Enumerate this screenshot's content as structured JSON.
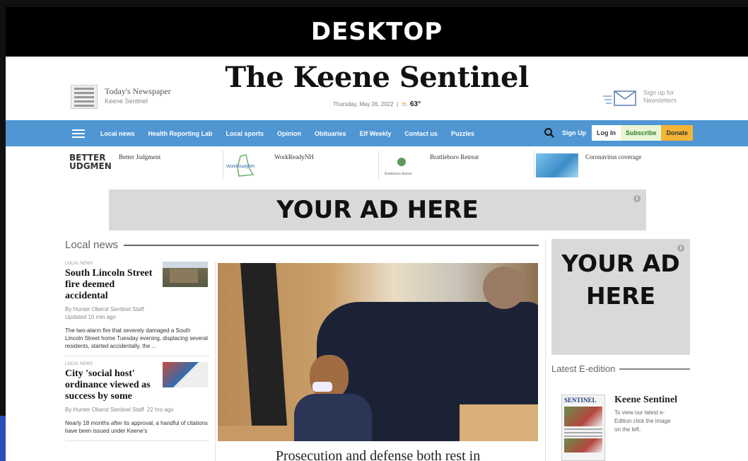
{
  "banner": {
    "label": "DESKTOP"
  },
  "masthead": {
    "todays_newspaper": "Today's Newspaper",
    "todays_sub": "Keene Sentinel",
    "logo": "The Keene Sentinel",
    "date": "Thursday, May 26, 2022",
    "temp": "63°",
    "newsletter": "Sign up for Newsletters"
  },
  "nav": {
    "items": [
      "Local news",
      "Health Reporting Lab",
      "Local sports",
      "Opinion",
      "Obituaries",
      "Elf Weekly",
      "Contact us",
      "Puzzles"
    ],
    "sign_up": "Sign Up",
    "log_in": "Log In",
    "subscribe": "Subscribe",
    "donate": "Donate"
  },
  "featured": [
    {
      "label": "Better Judgment",
      "thumb_text": "BETTER UDGMEN"
    },
    {
      "label": "WorkReadyNH",
      "thumb_text": "WorkReadyNH"
    },
    {
      "label": "Brattleboro Retreat",
      "thumb_text": "Brattleboro Retreat"
    },
    {
      "label": "Coronavirus coverage"
    }
  ],
  "ads": {
    "wide": "YOUR AD HERE",
    "box": "YOUR AD HERE",
    "info": "i"
  },
  "local_news": {
    "heading": "Local news",
    "stories": [
      {
        "kicker": "LOCAL NEWS",
        "headline": "South Lincoln Street fire deemed accidental",
        "byline": "By Hunter Oberst Sentinel Staff",
        "updated": "Updated 10 min ago",
        "summary": "The two-alarm fire that severely damaged a South Lincoln Street home Tuesday evening, displacing several residents, started accidentally, the ..."
      },
      {
        "kicker": "LOCAL NEWS",
        "headline": "City 'social host' ordinance viewed as success by some",
        "byline": "By Hunter Oberst Sentinel Staff",
        "updated": "22 hrs ago",
        "summary": "Nearly 18 months after its approval, a handful of citations have been issued under Keene's"
      }
    ],
    "main_headline": "Prosecution and defense both rest in"
  },
  "eedition": {
    "heading": "Latest E-edition",
    "title": "Keene Sentinel",
    "thumb_masthead": "SENTINEL",
    "description": "To view our latest e-Edition click the image on the left."
  }
}
